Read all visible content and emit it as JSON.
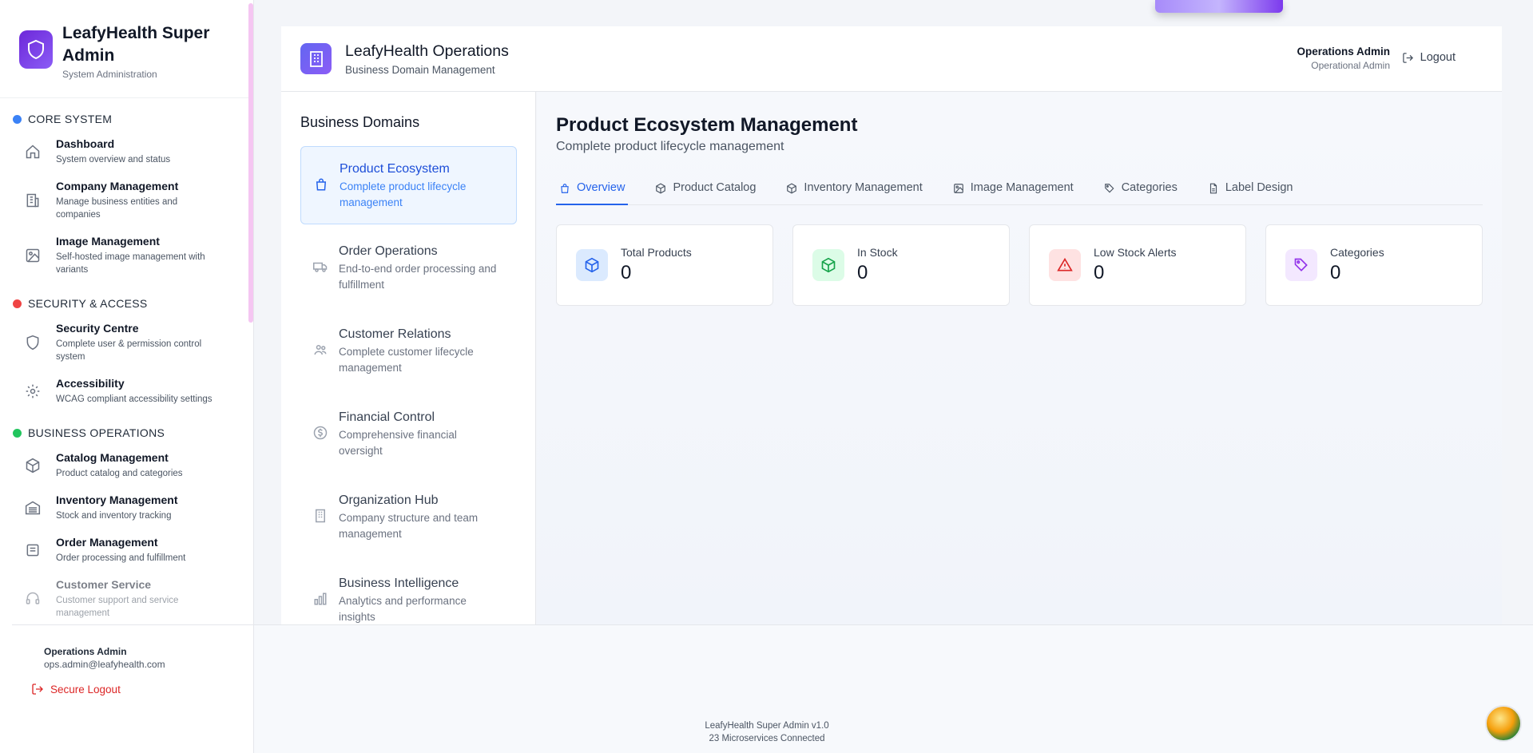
{
  "brand": {
    "title": "LeafyHealth Super Admin",
    "subtitle": "System Administration"
  },
  "sidebar": {
    "sections": [
      {
        "label": "CORE SYSTEM",
        "color": "#3b82f6"
      },
      {
        "label": "SECURITY & ACCESS",
        "color": "#ef4444"
      },
      {
        "label": "BUSINESS OPERATIONS",
        "color": "#22c55e"
      }
    ],
    "items": [
      {
        "title": "Dashboard",
        "desc": "System overview and status"
      },
      {
        "title": "Company Management",
        "desc": "Manage business entities and companies"
      },
      {
        "title": "Image Management",
        "desc": "Self-hosted image management with variants"
      },
      {
        "title": "Security Centre",
        "desc": "Complete user & permission control system"
      },
      {
        "title": "Accessibility",
        "desc": "WCAG compliant accessibility settings"
      },
      {
        "title": "Catalog Management",
        "desc": "Product catalog and categories"
      },
      {
        "title": "Inventory Management",
        "desc": "Stock and inventory tracking"
      },
      {
        "title": "Order Management",
        "desc": "Order processing and fulfillment"
      },
      {
        "title": "Customer Service",
        "desc": "Customer support and service management"
      }
    ],
    "footer": {
      "name": "Operations Admin",
      "email": "ops.admin@leafyhealth.com",
      "logout": "Secure Logout"
    }
  },
  "header": {
    "title": "LeafyHealth Operations",
    "subtitle": "Business Domain Management",
    "user_name": "Operations Admin",
    "user_role": "Operational Admin",
    "logout": "Logout"
  },
  "domains": {
    "title": "Business Domains",
    "items": [
      {
        "title": "Product Ecosystem",
        "desc": "Complete product lifecycle management"
      },
      {
        "title": "Order Operations",
        "desc": "End-to-end order processing and fulfillment"
      },
      {
        "title": "Customer Relations",
        "desc": "Complete customer lifecycle management"
      },
      {
        "title": "Financial Control",
        "desc": "Comprehensive financial oversight"
      },
      {
        "title": "Organization Hub",
        "desc": "Company structure and team management"
      },
      {
        "title": "Business Intelligence",
        "desc": "Analytics and performance insights"
      }
    ]
  },
  "main": {
    "title": "Product Ecosystem Management",
    "subtitle": "Complete product lifecycle management",
    "tabs": [
      "Overview",
      "Product Catalog",
      "Inventory Management",
      "Image Management",
      "Categories",
      "Label Design"
    ],
    "stats": [
      {
        "label": "Total Products",
        "value": "0",
        "icon": "cube-icon",
        "bg": "#dbeafe",
        "fg": "#2563eb"
      },
      {
        "label": "In Stock",
        "value": "0",
        "icon": "box-icon",
        "bg": "#dcfce7",
        "fg": "#16a34a"
      },
      {
        "label": "Low Stock Alerts",
        "value": "0",
        "icon": "alert-icon",
        "bg": "#fee2e2",
        "fg": "#dc2626"
      },
      {
        "label": "Categories",
        "value": "0",
        "icon": "tag-icon",
        "bg": "#f3e8ff",
        "fg": "#9333ea"
      }
    ]
  },
  "footer": {
    "version": "LeafyHealth Super Admin v1.0",
    "services": "23 Microservices Connected"
  }
}
